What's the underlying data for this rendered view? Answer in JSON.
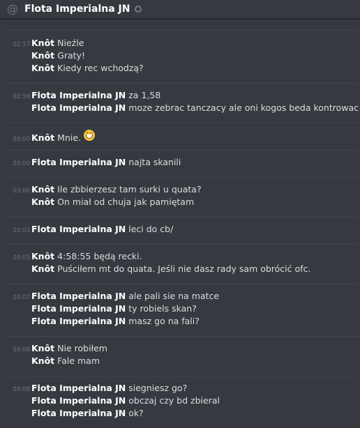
{
  "header": {
    "title": "Flota Imperialna JN",
    "icon": "at-icon"
  },
  "groups": [
    {
      "ts": "02:57",
      "lines": [
        {
          "author": "Knôt",
          "text": "Nieźle"
        },
        {
          "author": "Knôt",
          "text": "Graty!"
        },
        {
          "author": "Knôt",
          "text": "Kiedy rec wchodzą?"
        }
      ]
    },
    {
      "ts": "02:59",
      "lines": [
        {
          "author": "Flota Imperialna JN",
          "text": "za 1,58"
        },
        {
          "author": "Flota Imperialna JN",
          "text": "moze zebrac tanczacy ale oni kogos beda kontrowac"
        }
      ]
    },
    {
      "ts": "03:00",
      "lines": [
        {
          "author": "Knôt",
          "text": "Mnie."
        }
      ]
    },
    {
      "ts": "03:00",
      "lines": [
        {
          "author": "Flota Imperialna JN",
          "text": "najta skanili"
        }
      ]
    },
    {
      "ts": "03:00",
      "lines": [
        {
          "author": "Knôt",
          "text": "Ile zbbierzesz tam surki u quata?"
        },
        {
          "author": "Knôt",
          "text": "On miał od chuja jak pamiętam"
        }
      ]
    },
    {
      "ts": "03:03",
      "lines": [
        {
          "author": "Flota Imperialna JN",
          "text": "leci do cb/"
        }
      ]
    },
    {
      "ts": "03:05",
      "lines": [
        {
          "author": "Knôt",
          "text": "4:58:55 będą recki."
        },
        {
          "author": "Knôt",
          "text": "Puściłem mt do quata. Jeśli nie dasz rady sam obrócić ofc."
        }
      ]
    },
    {
      "ts": "03:07",
      "lines": [
        {
          "author": "Flota Imperialna JN",
          "text": "ale pali sie na matce"
        },
        {
          "author": "Flota Imperialna JN",
          "text": "ty robiels skan?"
        },
        {
          "author": "Flota Imperialna JN",
          "text": "masz go na fali?"
        }
      ]
    },
    {
      "ts": "03:08",
      "lines": [
        {
          "author": "Knôt",
          "text": "Nie robiłem"
        },
        {
          "author": "Knôt",
          "text": "Fale mam"
        }
      ]
    },
    {
      "ts": "03:08",
      "lines": [
        {
          "author": "Flota Imperialna JN",
          "text": "siegniesz go?"
        },
        {
          "author": "Flota Imperialna JN",
          "text": "obczaj czy bd zbieral"
        },
        {
          "author": "Flota Imperialna JN",
          "text": "ok?"
        }
      ]
    }
  ]
}
